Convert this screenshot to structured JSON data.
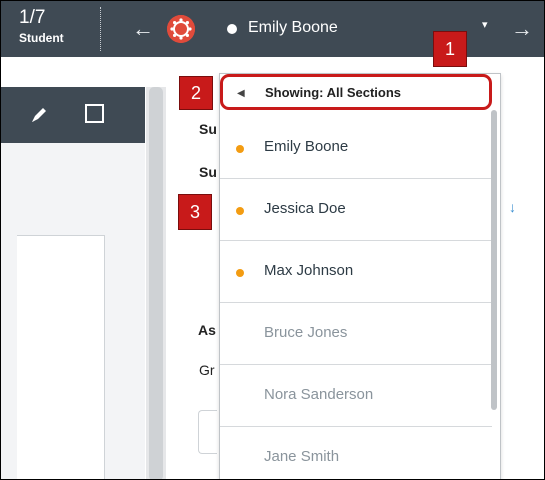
{
  "header": {
    "counter": "1/7",
    "role": "Student",
    "selected_student": "Emily Boone",
    "prev_arrow": "←",
    "next_arrow": "→",
    "dropdown_caret": "▾"
  },
  "callouts": [
    "1",
    "2",
    "3"
  ],
  "content_fragments": [
    "Su",
    "Su",
    "As",
    "Gr"
  ],
  "dropdown": {
    "section_filter": "Showing: All Sections",
    "students": [
      {
        "name": "Emily Boone",
        "status": "active"
      },
      {
        "name": "Jessica Doe",
        "status": "active"
      },
      {
        "name": "Max Johnson",
        "status": "active"
      },
      {
        "name": "Bruce Jones",
        "status": "inactive"
      },
      {
        "name": "Nora Sanderson",
        "status": "inactive"
      },
      {
        "name": "Jane Smith",
        "status": "inactive"
      }
    ]
  },
  "colors": {
    "topbar": "#3f4a54",
    "callout": "#c81a1a",
    "status_dot": "#f39c12",
    "avatar": "#e04b3b"
  },
  "icons": [
    "arrow-left-icon",
    "arrow-right-icon",
    "avatar-icon",
    "caret-down-icon",
    "pen-icon",
    "crop-square-icon",
    "triangle-left-icon",
    "arrow-down-icon"
  ]
}
